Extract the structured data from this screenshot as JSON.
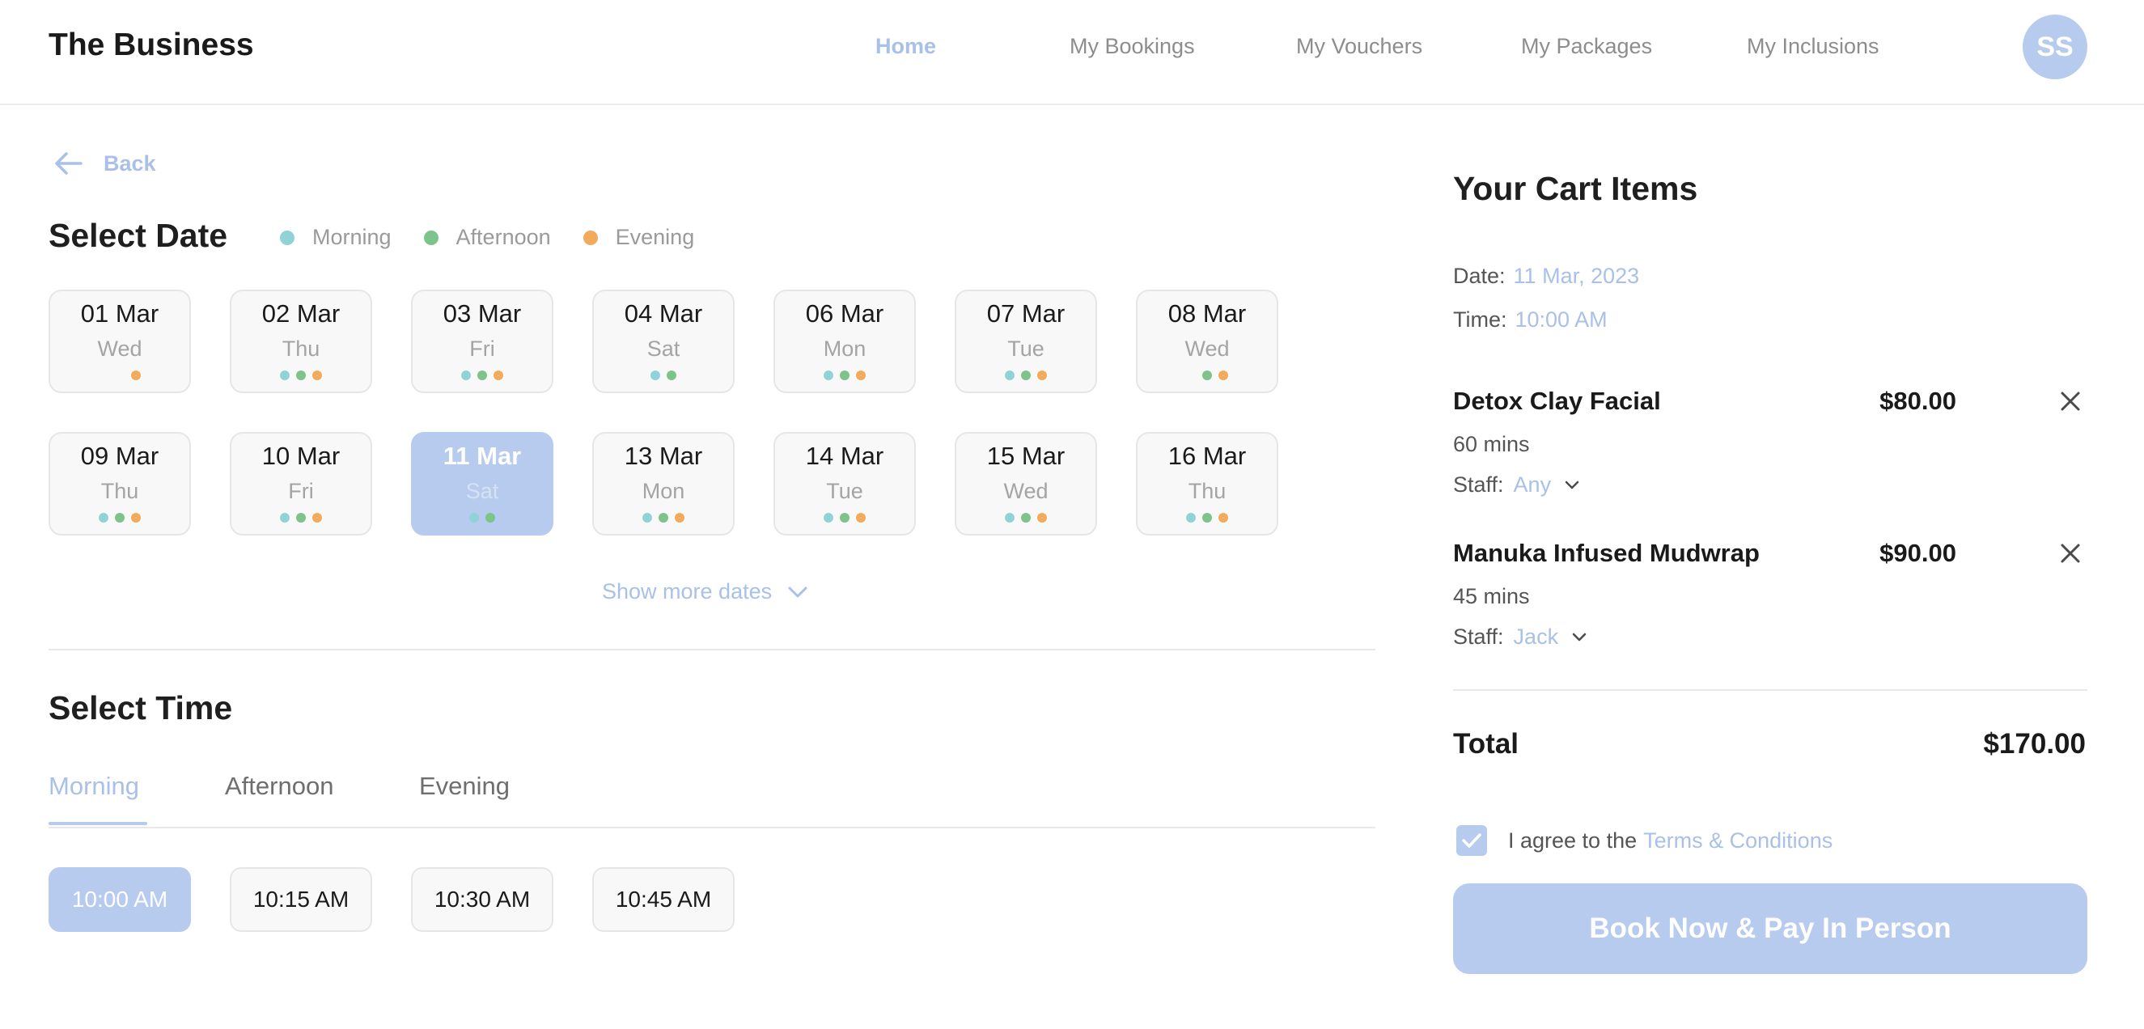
{
  "header": {
    "brand": "The Business",
    "nav": [
      {
        "label": "Home",
        "active": true
      },
      {
        "label": "My Bookings",
        "active": false
      },
      {
        "label": "My Vouchers",
        "active": false
      },
      {
        "label": "My Packages",
        "active": false
      },
      {
        "label": "My Inclusions",
        "active": false
      }
    ],
    "avatar_initials": "SS"
  },
  "back_label": "Back",
  "select_date": {
    "title": "Select Date",
    "legend": [
      {
        "label": "Morning",
        "color": "#8fd3d9"
      },
      {
        "label": "Afternoon",
        "color": "#7cc48a"
      },
      {
        "label": "Evening",
        "color": "#f2aa5c"
      }
    ],
    "dates": [
      {
        "day": "01 Mar",
        "weekday": "Wed",
        "morning": false,
        "afternoon": false,
        "evening": true,
        "selected": false
      },
      {
        "day": "02 Mar",
        "weekday": "Thu",
        "morning": true,
        "afternoon": true,
        "evening": true,
        "selected": false
      },
      {
        "day": "03 Mar",
        "weekday": "Fri",
        "morning": true,
        "afternoon": true,
        "evening": true,
        "selected": false
      },
      {
        "day": "04 Mar",
        "weekday": "Sat",
        "morning": true,
        "afternoon": true,
        "evening": false,
        "selected": false
      },
      {
        "day": "06 Mar",
        "weekday": "Mon",
        "morning": true,
        "afternoon": true,
        "evening": true,
        "selected": false
      },
      {
        "day": "07 Mar",
        "weekday": "Tue",
        "morning": true,
        "afternoon": true,
        "evening": true,
        "selected": false
      },
      {
        "day": "08 Mar",
        "weekday": "Wed",
        "morning": false,
        "afternoon": true,
        "evening": true,
        "selected": false
      },
      {
        "day": "09 Mar",
        "weekday": "Thu",
        "morning": true,
        "afternoon": true,
        "evening": true,
        "selected": false
      },
      {
        "day": "10 Mar",
        "weekday": "Fri",
        "morning": true,
        "afternoon": true,
        "evening": true,
        "selected": false
      },
      {
        "day": "11 Mar",
        "weekday": "Sat",
        "morning": true,
        "afternoon": true,
        "evening": false,
        "selected": true
      },
      {
        "day": "13 Mar",
        "weekday": "Mon",
        "morning": true,
        "afternoon": true,
        "evening": true,
        "selected": false
      },
      {
        "day": "14 Mar",
        "weekday": "Tue",
        "morning": true,
        "afternoon": true,
        "evening": true,
        "selected": false
      },
      {
        "day": "15 Mar",
        "weekday": "Wed",
        "morning": true,
        "afternoon": true,
        "evening": true,
        "selected": false
      },
      {
        "day": "16 Mar",
        "weekday": "Thu",
        "morning": true,
        "afternoon": true,
        "evening": true,
        "selected": false
      }
    ],
    "show_more_label": "Show more dates"
  },
  "select_time": {
    "title": "Select Time",
    "tabs": [
      {
        "label": "Morning",
        "active": true
      },
      {
        "label": "Afternoon",
        "active": false
      },
      {
        "label": "Evening",
        "active": false
      }
    ],
    "slots": [
      {
        "label": "10:00 AM",
        "selected": true
      },
      {
        "label": "10:15 AM",
        "selected": false
      },
      {
        "label": "10:30 AM",
        "selected": false
      },
      {
        "label": "10:45 AM",
        "selected": false
      }
    ]
  },
  "cart": {
    "title": "Your Cart Items",
    "date_label": "Date:",
    "date_value": "11 Mar, 2023",
    "time_label": "Time:",
    "time_value": "10:00 AM",
    "items": [
      {
        "name": "Detox Clay Facial",
        "price": "$80.00",
        "duration": "60 mins",
        "staff_label": "Staff:",
        "staff_value": "Any"
      },
      {
        "name": "Manuka Infused Mudwrap",
        "price": "$90.00",
        "duration": "45 mins",
        "staff_label": "Staff:",
        "staff_value": "Jack"
      }
    ],
    "total_label": "Total",
    "total_value": "$170.00",
    "agree_text": "I agree to the",
    "agree_link": "Terms & Conditions",
    "agree_checked": true,
    "book_button": "Book Now & Pay In Person"
  },
  "colors": {
    "accent": "#b7cbee",
    "accent_text": "#a9c0e8",
    "morning": "#8fd3d9",
    "afternoon": "#7cc48a",
    "evening": "#f2aa5c"
  }
}
